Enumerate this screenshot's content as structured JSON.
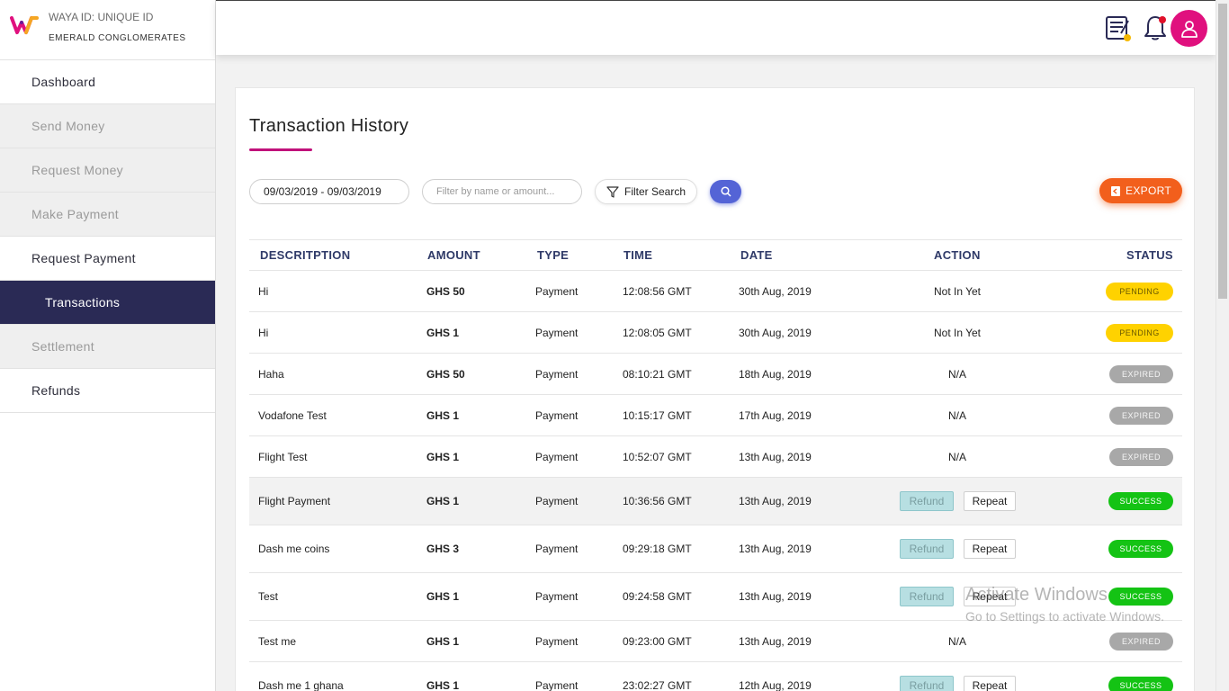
{
  "sidebar": {
    "waya_id": "WAYA ID: UNIQUE ID",
    "company": "EMERALD CONGLOMERATES",
    "items": [
      {
        "label": "Dashboard",
        "state": "enabled"
      },
      {
        "label": "Send Money",
        "state": "disabled"
      },
      {
        "label": "Request Money",
        "state": "disabled"
      },
      {
        "label": "Make Payment",
        "state": "disabled"
      },
      {
        "label": "Request Payment",
        "state": "enabled"
      },
      {
        "label": "Transactions",
        "state": "active"
      },
      {
        "label": "Settlement",
        "state": "disabled"
      },
      {
        "label": "Refunds",
        "state": "enabled"
      }
    ]
  },
  "header": {
    "icons": [
      "invoice-icon",
      "bell-icon",
      "user-icon"
    ]
  },
  "main": {
    "title": "Transaction History",
    "date_range": "09/03/2019 - 09/03/2019",
    "filter_placeholder": "Filter by name or amount...",
    "filter_search_label": "Filter Search",
    "export_label": "EXPORT"
  },
  "table": {
    "columns": [
      "DESCRITPTION",
      "AMOUNT",
      "TYPE",
      "TIME",
      "DATE",
      "ACTION",
      "STATUS"
    ],
    "rows": [
      {
        "description": "Hi",
        "amount": "GHS 50",
        "type": "Payment",
        "time": "12:08:56 GMT",
        "date": "30th Aug, 2019",
        "action": "Not In Yet",
        "status": "PENDING"
      },
      {
        "description": "Hi",
        "amount": "GHS 1",
        "type": "Payment",
        "time": "12:08:05 GMT",
        "date": "30th Aug, 2019",
        "action": "Not In Yet",
        "status": "PENDING"
      },
      {
        "description": "Haha",
        "amount": "GHS 50",
        "type": "Payment",
        "time": "08:10:21 GMT",
        "date": "18th Aug, 2019",
        "action": "N/A",
        "status": "EXPIRED"
      },
      {
        "description": "Vodafone Test",
        "amount": "GHS 1",
        "type": "Payment",
        "time": "10:15:17 GMT",
        "date": "17th Aug, 2019",
        "action": "N/A",
        "status": "EXPIRED"
      },
      {
        "description": "Flight Test",
        "amount": "GHS 1",
        "type": "Payment",
        "time": "10:52:07 GMT",
        "date": "13th Aug, 2019",
        "action": "N/A",
        "status": "EXPIRED"
      },
      {
        "description": "Flight Payment",
        "amount": "GHS 1",
        "type": "Payment",
        "time": "10:36:56 GMT",
        "date": "13th Aug, 2019",
        "action": "buttons",
        "refund_label": "Refund",
        "repeat_label": "Repeat",
        "status": "SUCCESS"
      },
      {
        "description": "Dash me coins",
        "amount": "GHS 3",
        "type": "Payment",
        "time": "09:29:18 GMT",
        "date": "13th Aug, 2019",
        "action": "buttons",
        "refund_label": "Refund",
        "repeat_label": "Repeat",
        "status": "SUCCESS"
      },
      {
        "description": "Test",
        "amount": "GHS 1",
        "type": "Payment",
        "time": "09:24:58 GMT",
        "date": "13th Aug, 2019",
        "action": "buttons",
        "refund_label": "Refund",
        "repeat_label": "Repeat",
        "status": "SUCCESS"
      },
      {
        "description": "Test me",
        "amount": "GHS 1",
        "type": "Payment",
        "time": "09:23:00 GMT",
        "date": "13th Aug, 2019",
        "action": "N/A",
        "status": "EXPIRED"
      },
      {
        "description": "Dash me 1 ghana",
        "amount": "GHS 1",
        "type": "Payment",
        "time": "23:02:27 GMT",
        "date": "12th Aug, 2019",
        "action": "buttons",
        "refund_label": "Refund",
        "repeat_label": "Repeat",
        "status": "SUCCESS"
      }
    ]
  },
  "watermark": {
    "line1": "Activate Windows",
    "line2": "Go to Settings to activate Windows."
  },
  "colors": {
    "sidebar_active": "#2a2a55",
    "accent_magenta": "#e0107e",
    "export_orange": "#f25f1c",
    "search_blue": "#5464d6",
    "pending": "#ffd200",
    "expired": "#a8a8a8",
    "success": "#14c314"
  }
}
